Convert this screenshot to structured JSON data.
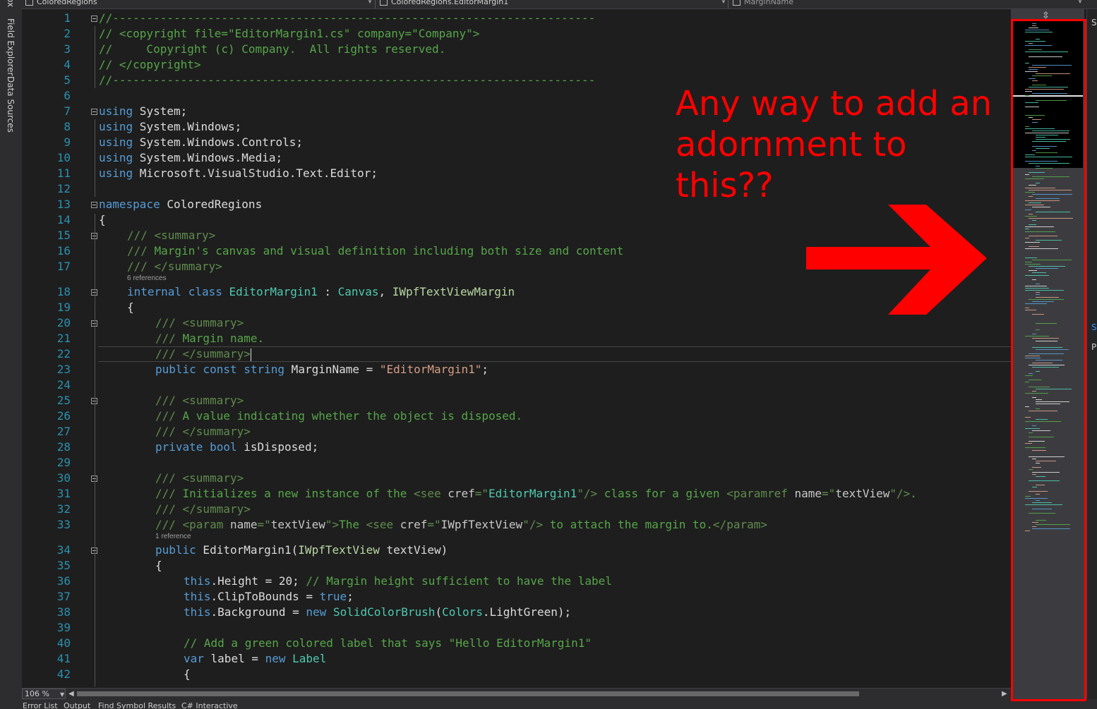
{
  "nav": {
    "project": "ColoredRegions",
    "type": "ColoredRegions.EditorMargin1",
    "member": "MarginName"
  },
  "left_tabs": [
    "ox",
    "Field Explorer",
    "Data Sources"
  ],
  "lines": [
    {
      "n": "1",
      "indent": 0,
      "fold": true,
      "segs": [
        {
          "c": "cm",
          "t": "//-----------------------------------------------------------------------"
        }
      ]
    },
    {
      "n": "2",
      "indent": 0,
      "segs": [
        {
          "c": "cm",
          "t": "// <copyright file=\"EditorMargin1.cs\" company=\"Company\">"
        }
      ]
    },
    {
      "n": "3",
      "indent": 0,
      "segs": [
        {
          "c": "cm",
          "t": "//     Copyright (c) Company.  All rights reserved."
        }
      ]
    },
    {
      "n": "4",
      "indent": 0,
      "segs": [
        {
          "c": "cm",
          "t": "// </copyright>"
        }
      ]
    },
    {
      "n": "5",
      "indent": 0,
      "segs": [
        {
          "c": "cm",
          "t": "//-----------------------------------------------------------------------"
        }
      ]
    },
    {
      "n": "6",
      "indent": 0,
      "segs": []
    },
    {
      "n": "7",
      "indent": 0,
      "fold": true,
      "segs": [
        {
          "c": "kw",
          "t": "using"
        },
        {
          "c": "",
          "t": " System;"
        }
      ]
    },
    {
      "n": "8",
      "indent": 0,
      "segs": [
        {
          "c": "kw",
          "t": "using"
        },
        {
          "c": "",
          "t": " System.Windows;"
        }
      ]
    },
    {
      "n": "9",
      "indent": 0,
      "segs": [
        {
          "c": "kw",
          "t": "using"
        },
        {
          "c": "",
          "t": " System.Windows.Controls;"
        }
      ]
    },
    {
      "n": "10",
      "indent": 0,
      "segs": [
        {
          "c": "kw",
          "t": "using"
        },
        {
          "c": "",
          "t": " System.Windows.Media;"
        }
      ]
    },
    {
      "n": "11",
      "indent": 0,
      "segs": [
        {
          "c": "kw",
          "t": "using"
        },
        {
          "c": "",
          "t": " Microsoft.VisualStudio.Text.Editor;"
        }
      ]
    },
    {
      "n": "12",
      "indent": 0,
      "segs": []
    },
    {
      "n": "13",
      "indent": 0,
      "fold": true,
      "segs": [
        {
          "c": "kw",
          "t": "namespace"
        },
        {
          "c": "",
          "t": " ColoredRegions"
        }
      ]
    },
    {
      "n": "14",
      "indent": 0,
      "segs": [
        {
          "c": "",
          "t": "{"
        }
      ]
    },
    {
      "n": "15",
      "indent": 1,
      "fold": true,
      "segs": [
        {
          "c": "xd",
          "t": "/// <summary>"
        }
      ]
    },
    {
      "n": "16",
      "indent": 1,
      "segs": [
        {
          "c": "xd",
          "t": "/// "
        },
        {
          "c": "cm",
          "t": "Margin's canvas and visual definition including both size and content"
        }
      ]
    },
    {
      "n": "17",
      "indent": 1,
      "segs": [
        {
          "c": "xd",
          "t": "/// </summary>"
        }
      ]
    },
    {
      "n": "18",
      "indent": 1,
      "fold": true,
      "lens": "6 references",
      "segs": [
        {
          "c": "kw",
          "t": "internal"
        },
        {
          "c": "",
          "t": " "
        },
        {
          "c": "kw",
          "t": "class"
        },
        {
          "c": "",
          "t": " "
        },
        {
          "c": "ty",
          "t": "EditorMargin1"
        },
        {
          "c": "",
          "t": " : "
        },
        {
          "c": "ty",
          "t": "Canvas"
        },
        {
          "c": "",
          "t": ", "
        },
        {
          "c": "if",
          "t": "IWpfTextViewMargin"
        }
      ]
    },
    {
      "n": "19",
      "indent": 1,
      "segs": [
        {
          "c": "",
          "t": "{"
        }
      ]
    },
    {
      "n": "20",
      "indent": 2,
      "fold": true,
      "segs": [
        {
          "c": "xd",
          "t": "/// <summary>"
        }
      ]
    },
    {
      "n": "21",
      "indent": 2,
      "segs": [
        {
          "c": "xd",
          "t": "/// "
        },
        {
          "c": "cm",
          "t": "Margin name."
        }
      ]
    },
    {
      "n": "22",
      "indent": 2,
      "current": true,
      "segs": [
        {
          "c": "xd",
          "t": "/// </summary>"
        }
      ]
    },
    {
      "n": "23",
      "indent": 2,
      "segs": [
        {
          "c": "kw",
          "t": "public"
        },
        {
          "c": "",
          "t": " "
        },
        {
          "c": "kw",
          "t": "const"
        },
        {
          "c": "",
          "t": " "
        },
        {
          "c": "kw",
          "t": "string"
        },
        {
          "c": "",
          "t": " MarginName = "
        },
        {
          "c": "st",
          "t": "\"EditorMargin1\""
        },
        {
          "c": "",
          "t": ";"
        }
      ]
    },
    {
      "n": "24",
      "indent": 2,
      "segs": []
    },
    {
      "n": "25",
      "indent": 2,
      "fold": true,
      "segs": [
        {
          "c": "xd",
          "t": "/// <summary>"
        }
      ]
    },
    {
      "n": "26",
      "indent": 2,
      "segs": [
        {
          "c": "xd",
          "t": "/// "
        },
        {
          "c": "cm",
          "t": "A value indicating whether the object is disposed."
        }
      ]
    },
    {
      "n": "27",
      "indent": 2,
      "segs": [
        {
          "c": "xd",
          "t": "/// </summary>"
        }
      ]
    },
    {
      "n": "28",
      "indent": 2,
      "segs": [
        {
          "c": "kw",
          "t": "private"
        },
        {
          "c": "",
          "t": " "
        },
        {
          "c": "kw",
          "t": "bool"
        },
        {
          "c": "",
          "t": " isDisposed;"
        }
      ]
    },
    {
      "n": "29",
      "indent": 2,
      "segs": []
    },
    {
      "n": "30",
      "indent": 2,
      "fold": true,
      "segs": [
        {
          "c": "xd",
          "t": "/// <summary>"
        }
      ]
    },
    {
      "n": "31",
      "indent": 2,
      "segs": [
        {
          "c": "xd",
          "t": "/// "
        },
        {
          "c": "cm",
          "t": "Initializes a new instance of the "
        },
        {
          "c": "xd",
          "t": "<see "
        },
        {
          "c": "xa",
          "t": "cref"
        },
        {
          "c": "xd",
          "t": "=\""
        },
        {
          "c": "ty",
          "t": "EditorMargin1"
        },
        {
          "c": "xd",
          "t": "\"/>"
        },
        {
          "c": "cm",
          "t": " class for a given "
        },
        {
          "c": "xd",
          "t": "<paramref "
        },
        {
          "c": "xa",
          "t": "name"
        },
        {
          "c": "xd",
          "t": "=\""
        },
        {
          "c": "xa",
          "t": "textView"
        },
        {
          "c": "xd",
          "t": "\"/>"
        },
        {
          "c": "cm",
          "t": "."
        }
      ]
    },
    {
      "n": "32",
      "indent": 2,
      "segs": [
        {
          "c": "xd",
          "t": "/// </summary>"
        }
      ]
    },
    {
      "n": "33",
      "indent": 2,
      "segs": [
        {
          "c": "xd",
          "t": "/// <param "
        },
        {
          "c": "xa",
          "t": "name"
        },
        {
          "c": "xd",
          "t": "=\""
        },
        {
          "c": "xa",
          "t": "textView"
        },
        {
          "c": "xd",
          "t": "\">"
        },
        {
          "c": "cm",
          "t": "The "
        },
        {
          "c": "xd",
          "t": "<see "
        },
        {
          "c": "xa",
          "t": "cref"
        },
        {
          "c": "xd",
          "t": "=\""
        },
        {
          "c": "xa",
          "t": "IWpfTextView"
        },
        {
          "c": "xd",
          "t": "\"/>"
        },
        {
          "c": "cm",
          "t": " to attach the margin to."
        },
        {
          "c": "xd",
          "t": "</param>"
        }
      ]
    },
    {
      "n": "34",
      "indent": 2,
      "fold": true,
      "lens": "1 reference",
      "segs": [
        {
          "c": "kw",
          "t": "public"
        },
        {
          "c": "",
          "t": " EditorMargin1("
        },
        {
          "c": "if",
          "t": "IWpfTextView"
        },
        {
          "c": "",
          "t": " textView)"
        }
      ]
    },
    {
      "n": "35",
      "indent": 2,
      "segs": [
        {
          "c": "",
          "t": "{"
        }
      ]
    },
    {
      "n": "36",
      "indent": 3,
      "segs": [
        {
          "c": "kw",
          "t": "this"
        },
        {
          "c": "",
          "t": ".Height = 20; "
        },
        {
          "c": "cm",
          "t": "// Margin height sufficient to have the label"
        }
      ]
    },
    {
      "n": "37",
      "indent": 3,
      "segs": [
        {
          "c": "kw",
          "t": "this"
        },
        {
          "c": "",
          "t": ".ClipToBounds = "
        },
        {
          "c": "kw",
          "t": "true"
        },
        {
          "c": "",
          "t": ";"
        }
      ]
    },
    {
      "n": "38",
      "indent": 3,
      "segs": [
        {
          "c": "kw",
          "t": "this"
        },
        {
          "c": "",
          "t": ".Background = "
        },
        {
          "c": "kw",
          "t": "new"
        },
        {
          "c": "",
          "t": " "
        },
        {
          "c": "ty",
          "t": "SolidColorBrush"
        },
        {
          "c": "",
          "t": "("
        },
        {
          "c": "ty",
          "t": "Colors"
        },
        {
          "c": "",
          "t": ".LightGreen);"
        }
      ]
    },
    {
      "n": "39",
      "indent": 3,
      "segs": []
    },
    {
      "n": "40",
      "indent": 3,
      "segs": [
        {
          "c": "cm",
          "t": "// Add a green colored label that says \"Hello EditorMargin1\""
        }
      ]
    },
    {
      "n": "41",
      "indent": 3,
      "segs": [
        {
          "c": "kw",
          "t": "var"
        },
        {
          "c": "",
          "t": " label = "
        },
        {
          "c": "kw",
          "t": "new"
        },
        {
          "c": "",
          "t": " "
        },
        {
          "c": "ty",
          "t": "Label"
        }
      ]
    },
    {
      "n": "42",
      "indent": 3,
      "segs": [
        {
          "c": "",
          "t": "{"
        }
      ]
    }
  ],
  "zoom": "106 %",
  "bottom_tabs": [
    "Error List",
    "Output",
    "Find Symbol Results",
    "C# Interactive"
  ],
  "right_panel": [
    "Sc",
    "Sc",
    "Pr"
  ],
  "annotation": "Any way to add an adornment to this??",
  "colors": {
    "background": "#1e1e1e",
    "comment": "#57a64a",
    "keyword": "#569cd6",
    "type": "#4ec9b0",
    "interface": "#b8d7a3",
    "string": "#d69d85",
    "line_number": "#2b91af",
    "annotation_red": "#ff0000"
  },
  "icons": [
    "split-view-icon",
    "dropdown-arrow-icon",
    "scroll-left-icon",
    "scroll-right-icon",
    "red-arrow-icon"
  ]
}
